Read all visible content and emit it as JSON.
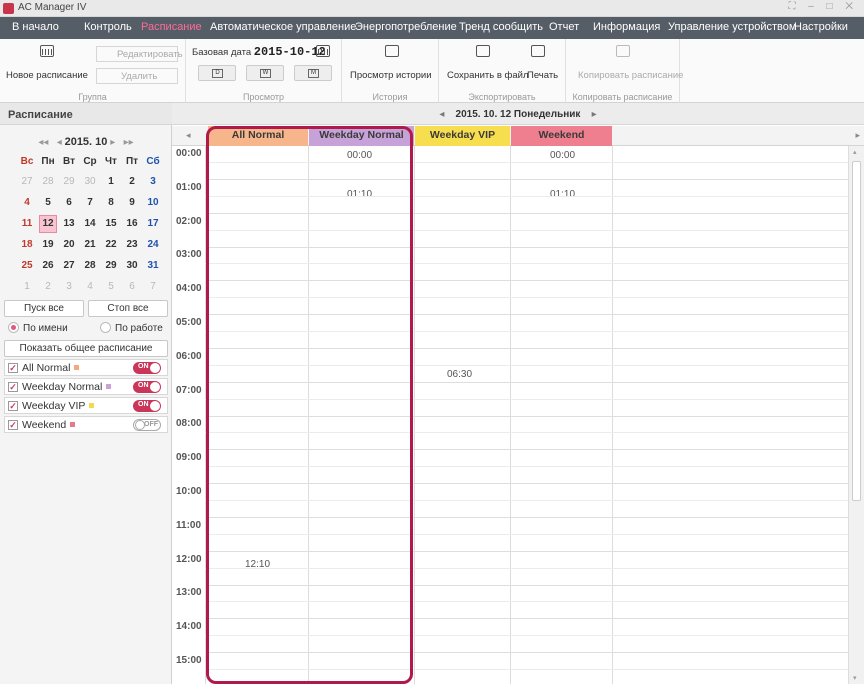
{
  "app": {
    "title": "AC Manager IV",
    "window_controls": "⛶ – □ ✕"
  },
  "menu": [
    {
      "label": "В начало"
    },
    {
      "label": "Контроль"
    },
    {
      "label": "Расписание"
    },
    {
      "label": "Автоматическое управление"
    },
    {
      "label": "Энергопотребление"
    },
    {
      "label": "Тренд сообщить"
    },
    {
      "label": "Отчет"
    },
    {
      "label": "Информация"
    },
    {
      "label": "Управление устройством"
    },
    {
      "label": "Настройки"
    }
  ],
  "ribbon": {
    "group": {
      "label": "Группа",
      "new": "Новое расписание",
      "edit": "Редактировать",
      "delete": "Удалить"
    },
    "view": {
      "label": "Просмотр",
      "base_date_label": "Базовая дата",
      "base_date": "2015-10-12",
      "day": "D",
      "week": "W",
      "month": "M"
    },
    "history": {
      "label": "История",
      "view_history": "Просмотр истории"
    },
    "export": {
      "label": "Экспортировать",
      "save_file": "Сохранить в файл",
      "print": "Печать"
    },
    "copy": {
      "label": "Копировать расписание",
      "copy_schedule": "Копировать расписание"
    }
  },
  "sidebar": {
    "title": "Расписание",
    "calendar": {
      "nav_prev_year": "◂◂",
      "nav_prev": "◂",
      "year_month": "2015. 10",
      "nav_next": "▸",
      "nav_next_year": "▸▸",
      "weekdays": [
        "Вс",
        "Пн",
        "Вт",
        "Ср",
        "Чт",
        "Пт",
        "Сб"
      ],
      "weeks": [
        [
          "27",
          "28",
          "29",
          "30",
          "1",
          "2",
          "3"
        ],
        [
          "4",
          "5",
          "6",
          "7",
          "8",
          "9",
          "10"
        ],
        [
          "11",
          "12",
          "13",
          "14",
          "15",
          "16",
          "17"
        ],
        [
          "18",
          "19",
          "20",
          "21",
          "22",
          "23",
          "24"
        ],
        [
          "25",
          "26",
          "27",
          "28",
          "29",
          "30",
          "31"
        ],
        [
          "1",
          "2",
          "3",
          "4",
          "5",
          "6",
          "7"
        ]
      ]
    },
    "start_all": "Пуск все",
    "stop_all": "Стоп все",
    "by_name": "По имени",
    "by_work": "По работе",
    "show_common": "Показать общее расписание",
    "schedules": [
      {
        "name": "All Normal",
        "color": "#f4a87c",
        "toggle": "ON"
      },
      {
        "name": "Weekday Normal",
        "color": "#c9a3d6",
        "toggle": "ON"
      },
      {
        "name": "Weekday VIP",
        "color": "#f5d94a",
        "toggle": "ON"
      },
      {
        "name": "Weekend",
        "color": "#e8798b",
        "toggle": "OFF"
      }
    ],
    "check_mark": "✓"
  },
  "main": {
    "date_nav": {
      "prev": "◂",
      "date": "2015. 10. 12 Понедельник",
      "next": "▸"
    },
    "columns": [
      {
        "name": "All Normal",
        "color": "#f6b58a"
      },
      {
        "name": "Weekday Normal",
        "color": "#c7a2d8"
      },
      {
        "name": "Weekday VIP",
        "color": "#f7de4f"
      },
      {
        "name": "Weekend",
        "color": "#ef7f8f"
      }
    ],
    "hours": [
      "00:00",
      "01:00",
      "02:00",
      "03:00",
      "04:00",
      "05:00",
      "06:00",
      "07:00",
      "08:00",
      "09:00",
      "10:00",
      "11:00",
      "12:00",
      "13:00",
      "14:00",
      "15:00"
    ],
    "events": {
      "weekday_normal_1": "00:00",
      "weekday_normal_2": "01:10",
      "weekend_1": "00:00",
      "weekend_2": "01:10",
      "weekday_vip_1": "06:30",
      "all_normal_1": "12:10"
    }
  }
}
